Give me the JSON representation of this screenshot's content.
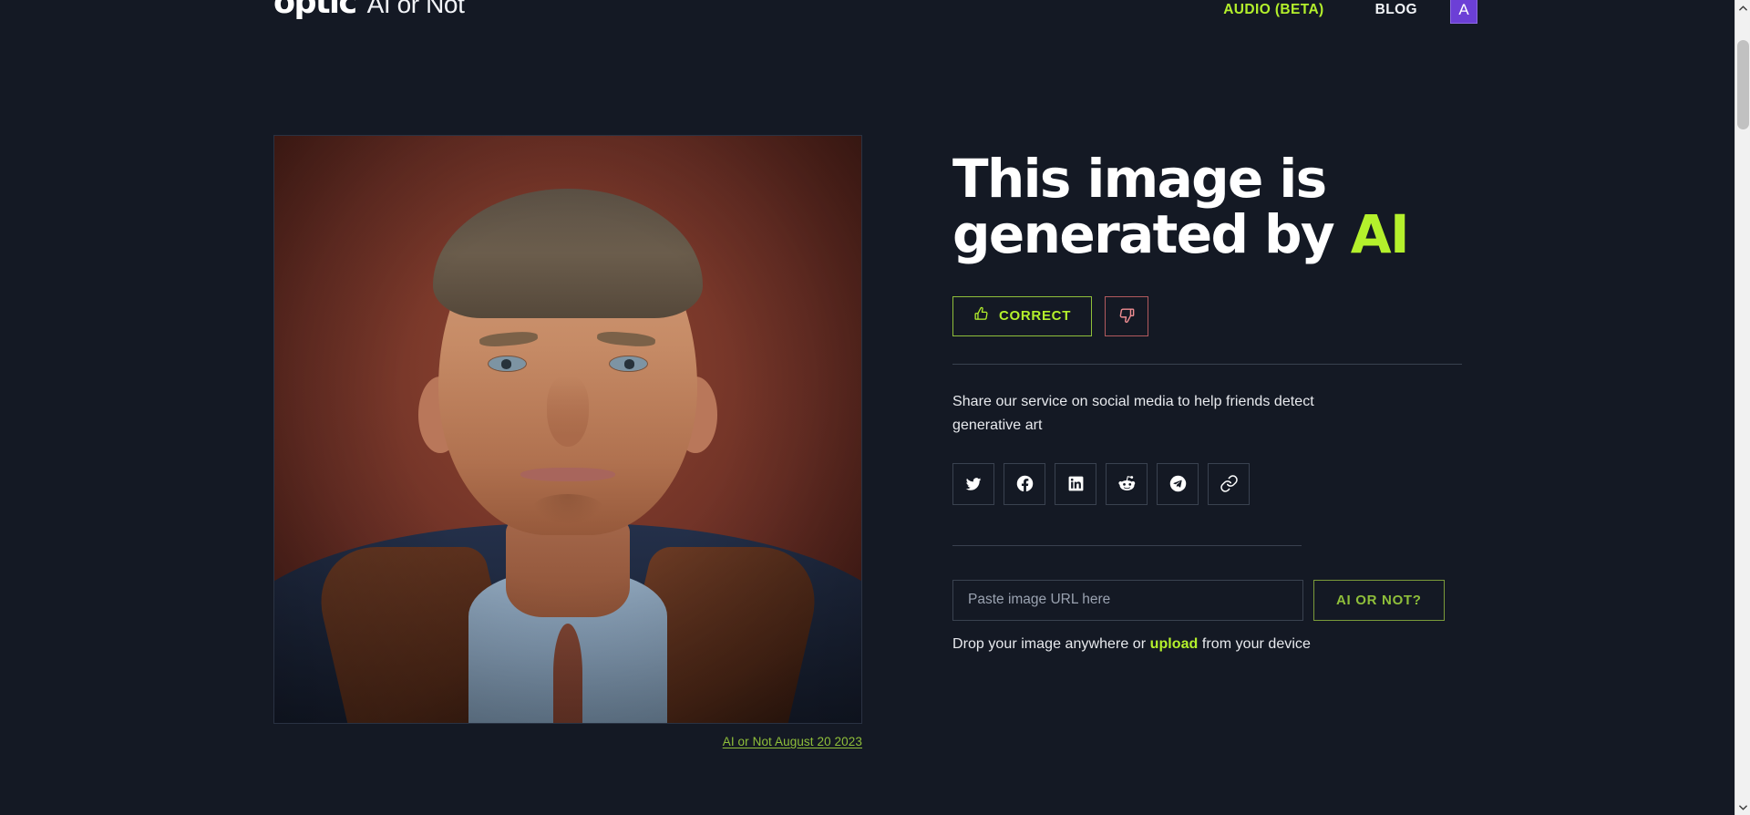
{
  "header": {
    "logo_text": "optic",
    "logo_subtitle": "AI or Not",
    "nav": {
      "audio_label": "AUDIO (BETA)",
      "blog_label": "BLOG",
      "avatar_initial": "A"
    }
  },
  "result": {
    "verdict_prefix": "This image is generated by",
    "verdict_accent": "AI",
    "image_caption": "AI or Not August 20 2023",
    "feedback": {
      "correct_label": "CORRECT",
      "thumbs_up_icon": "thumbs-up-icon",
      "thumbs_down_icon": "thumbs-down-icon"
    }
  },
  "share": {
    "description": "Share our service on social media to help friends detect generative art",
    "buttons": [
      {
        "name": "twitter",
        "icon": "twitter-icon"
      },
      {
        "name": "facebook",
        "icon": "facebook-icon"
      },
      {
        "name": "linkedin",
        "icon": "linkedin-icon"
      },
      {
        "name": "reddit",
        "icon": "reddit-icon"
      },
      {
        "name": "telegram",
        "icon": "telegram-icon"
      },
      {
        "name": "copylink",
        "icon": "link-icon"
      }
    ]
  },
  "upload": {
    "url_placeholder": "Paste image URL here",
    "url_value": "",
    "submit_label": "AI OR NOT?",
    "drop_text_before": "Drop your image anywhere or ",
    "drop_link": "upload",
    "drop_text_after": " from your device"
  },
  "colors": {
    "background": "#141924",
    "accent_green": "#b4f02c",
    "accent_green_dim": "#8fbf3a",
    "negative_red": "#b25a5e",
    "avatar_purple": "#6c3fd6",
    "border": "#3a4250"
  },
  "scrollbar": {
    "up_arrow_icon": "chevron-up-icon",
    "down_arrow_icon": "chevron-down-icon"
  }
}
